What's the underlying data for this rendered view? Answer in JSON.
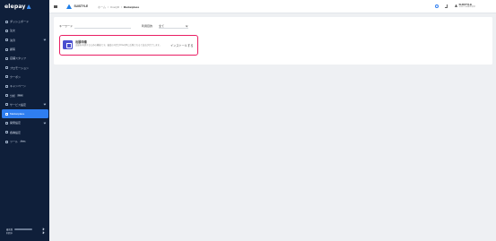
{
  "sidebar": {
    "brand": "elepay",
    "items": [
      {
        "label": "ダッシュボード",
        "icon": "dashboard-icon",
        "chevron": false,
        "badge": ""
      },
      {
        "label": "注文",
        "icon": "order-icon",
        "chevron": false,
        "badge": ""
      },
      {
        "label": "決済",
        "icon": "payment-icon",
        "chevron": true,
        "badge": ""
      },
      {
        "label": "顧客",
        "icon": "customer-icon",
        "chevron": false,
        "badge": ""
      },
      {
        "label": "店舗スタッフ",
        "icon": "staff-icon",
        "chevron": false,
        "badge": ""
      },
      {
        "label": "プロモーション",
        "icon": "promotion-icon",
        "chevron": false,
        "badge": ""
      },
      {
        "label": "クーポン",
        "icon": "coupon-icon",
        "chevron": false,
        "badge": ""
      },
      {
        "label": "キャンペーン",
        "icon": "campaign-icon",
        "chevron": false,
        "badge": ""
      },
      {
        "label": "分析",
        "icon": "analytics-icon",
        "chevron": false,
        "badge": "Beta"
      },
      {
        "label": "サービス設定",
        "icon": "service-settings-icon",
        "chevron": true,
        "badge": ""
      },
      {
        "label": "Marketplace",
        "icon": "marketplace-icon",
        "chevron": false,
        "badge": "",
        "active": true
      },
      {
        "label": "開発設定",
        "icon": "developer-settings-icon",
        "chevron": true,
        "badge": ""
      },
      {
        "label": "各種設定",
        "icon": "settings-icon",
        "chevron": false,
        "badge": ""
      },
      {
        "label": "ツール",
        "icon": "tools-icon",
        "chevron": false,
        "badge": "Beta"
      }
    ],
    "footer": {
      "line1": "最新版",
      "line2": "利用中"
    }
  },
  "topbar": {
    "org_name": "SUISTYLE",
    "breadcrumb": [
      "ホーム",
      "OneQR",
      "Marketplace"
    ],
    "breadcrumb_sep": "/",
    "user_name": "SUISTYLE",
    "user_sub": "SUISTYLE株式会社"
  },
  "filters": {
    "keyword_label": "キーワード",
    "keyword_value": "",
    "category_label": "利用目的",
    "category_value": "全て"
  },
  "app_card": {
    "name": "出展申請",
    "description": "出展を申請するための機能です。審査の可否がOneQRに反映されると出店が完了します。",
    "install_label": "インストールする",
    "icon": "shop-icon"
  },
  "colors": {
    "sidebar_bg": "#0f1f3a",
    "accent": "#2f7ef0",
    "highlight": "#e91e63",
    "app_icon": "#4a4fcf"
  }
}
